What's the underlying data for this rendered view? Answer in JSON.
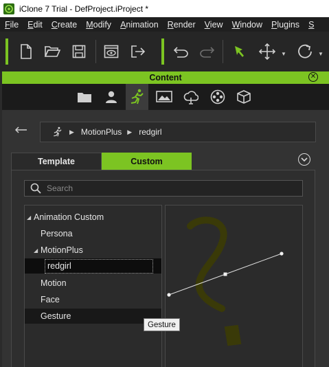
{
  "window": {
    "title": "iClone 7 Trial - DefProject.iProject *"
  },
  "menubar": {
    "items": [
      {
        "label": "File",
        "mnemonic": "F",
        "rest": "ile"
      },
      {
        "label": "Edit",
        "mnemonic": "E",
        "rest": "dit"
      },
      {
        "label": "Create",
        "mnemonic": "C",
        "rest": "reate"
      },
      {
        "label": "Modify",
        "mnemonic": "M",
        "rest": "odify"
      },
      {
        "label": "Animation",
        "mnemonic": "A",
        "rest": "nimation"
      },
      {
        "label": "Render",
        "mnemonic": "R",
        "rest": "ender"
      },
      {
        "label": "View",
        "mnemonic": "V",
        "rest": "iew"
      },
      {
        "label": "Window",
        "mnemonic": "W",
        "rest": "indow"
      },
      {
        "label": "Plugins",
        "mnemonic": "P",
        "rest": "lugins"
      },
      {
        "label": "S",
        "mnemonic": "S",
        "rest": ""
      }
    ]
  },
  "toolbar": {
    "icons": [
      "new-file-icon",
      "open-folder-icon",
      "save-icon",
      "preview-icon",
      "export-icon",
      "undo-icon",
      "redo-icon",
      "select-arrow-icon",
      "move-icon",
      "rotate-icon"
    ],
    "accent": "#7cc422"
  },
  "content_panel": {
    "title": "Content",
    "tabs": [
      "folder-tab",
      "actor-tab",
      "motion-tab",
      "stage-tab",
      "scene-tab",
      "media-tab",
      "props-tab"
    ],
    "active_tab": "motion-tab",
    "breadcrumb": [
      "MotionPlus",
      "redgirl"
    ],
    "mode_tabs": {
      "template": "Template",
      "custom": "Custom"
    },
    "search": {
      "placeholder": "Search",
      "value": ""
    },
    "tree": {
      "root": "Animation Custom",
      "persona": "Persona",
      "motionplus": "MotionPlus",
      "redgirl": "redgirl",
      "motion": "Motion",
      "face": "Face",
      "gesture": "Gesture"
    },
    "tooltip": "Gesture"
  }
}
